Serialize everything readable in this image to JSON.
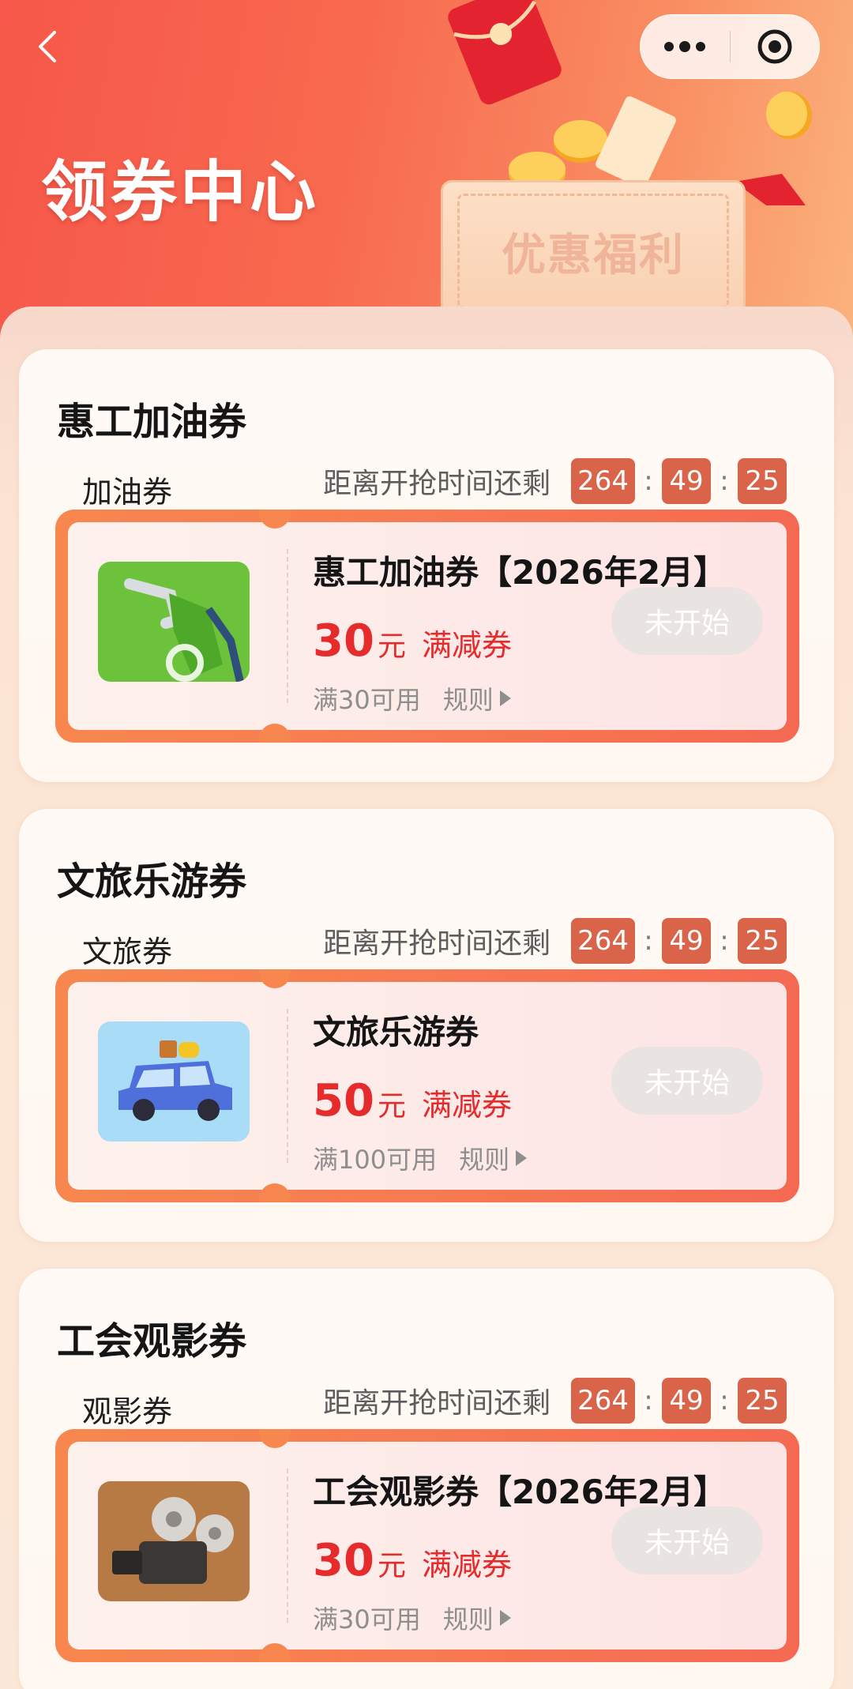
{
  "header": {
    "title": "领券中心",
    "banner_text": "优惠福利",
    "back_icon": "chevron-left-icon",
    "menu_icon": "more-dots-icon",
    "close_icon": "target-circle-icon"
  },
  "countdown_label": "距离开抢时间还剩",
  "colors": {
    "accent_red": "#e52b2b",
    "timer_bg": "#d9644a",
    "ticket_border": "#f7874f",
    "disabled_btn": "#e9e3e1"
  },
  "sections": [
    {
      "title": "惠工加油券",
      "subtitle": "加油券",
      "timer": {
        "hours": "264",
        "minutes": "49",
        "seconds": "25"
      },
      "coupon": {
        "name": "惠工加油券【2026年2月】",
        "amount": "30",
        "unit": "元",
        "type": "满减券",
        "condition": "满30可用",
        "rules": "规则",
        "status": "未开始",
        "image": "fuel-nozzle-icon"
      }
    },
    {
      "title": "文旅乐游券",
      "subtitle": "文旅券",
      "timer": {
        "hours": "264",
        "minutes": "49",
        "seconds": "25"
      },
      "coupon": {
        "name": "文旅乐游券",
        "amount": "50",
        "unit": "元",
        "type": "满减券",
        "condition": "满100可用",
        "rules": "规则",
        "status": "未开始",
        "image": "travel-car-icon"
      }
    },
    {
      "title": "工会观影券",
      "subtitle": "观影券",
      "timer": {
        "hours": "264",
        "minutes": "49",
        "seconds": "25"
      },
      "coupon": {
        "name": "工会观影券【2026年2月】",
        "amount": "30",
        "unit": "元",
        "type": "满减券",
        "condition": "满30可用",
        "rules": "规则",
        "status": "未开始",
        "image": "film-projector-icon"
      }
    }
  ]
}
